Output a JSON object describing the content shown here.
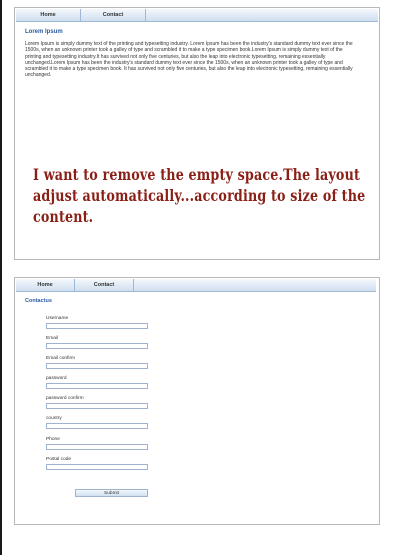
{
  "panel1": {
    "nav": [
      "Home",
      "Contact"
    ],
    "title": "Lorem Ipsum",
    "body": "Lorem Ipsum is simply dummy text of the printing and typesetting industry. Lorem Ipsum has been the industry's standard dummy text ever since the 1500s, when an unknown printer took a galley of type and scrambled it to make a type specimen book.Lorem Ipsum is simply dummy text of the printing and typesetting industry.It has survived not only five centuries, but also the leap into electronic typesetting, remaining essentially unchanged.Lorem Ipsum has been the industry's standard dummy text ever since the 1500s, when an unknown printer took a galley of type and scrambled it to make a type specimen book. It has survived not only five centuries, but also the leap into electronic typesetting, remaining essentially unchanged.",
    "annotation": "I want to remove the empty space.The layout adjust automatically...according to size of the content."
  },
  "panel2": {
    "nav": [
      "Home",
      "Contact"
    ],
    "title": "Contactus",
    "fields": [
      "Username",
      "Email",
      "Email confirm",
      "password",
      "password confirm",
      "country",
      "Phone",
      "Postal code"
    ],
    "submit": "Submit"
  }
}
